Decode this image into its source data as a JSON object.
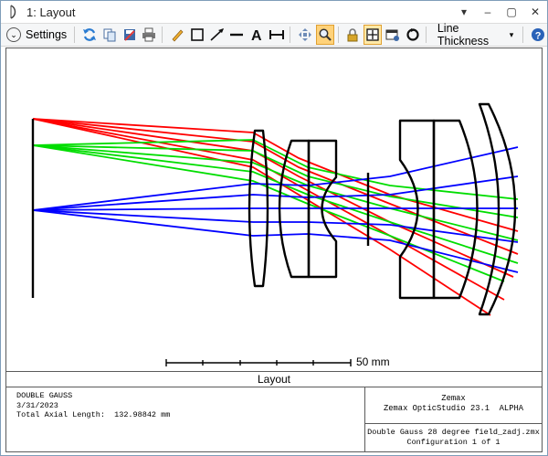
{
  "window": {
    "title": "1: Layout"
  },
  "toolbar": {
    "settings_label": "Settings",
    "line_thickness_label": "Line Thickness",
    "icons": [
      "refresh-icon",
      "copy-icon",
      "save-icon",
      "print-icon",
      "pencil-icon",
      "rectangle-icon",
      "arrow-icon",
      "line-icon",
      "text-icon",
      "dimension-icon",
      "pan-icon",
      "zoom-icon",
      "lock-icon",
      "frame-icon",
      "window-icon",
      "rotate-icon",
      "help-icon"
    ]
  },
  "plot": {
    "scale_label": "50 mm",
    "title": "Layout",
    "colors": {
      "field1": "#ff0000",
      "field2": "#00dd00",
      "field3": "#0000ff",
      "lens": "#000000"
    }
  },
  "info": {
    "lens_name": "DOUBLE GAUSS",
    "date": "3/31/2023",
    "axial_length": "Total Axial Length:  132.98842 mm",
    "company": "Zemax",
    "software": "Zemax OpticStudio 23.1  ALPHA",
    "file_name": "Double Gauss 28 degree field_zadj.zmx",
    "configuration": "Configuration 1 of 1"
  }
}
